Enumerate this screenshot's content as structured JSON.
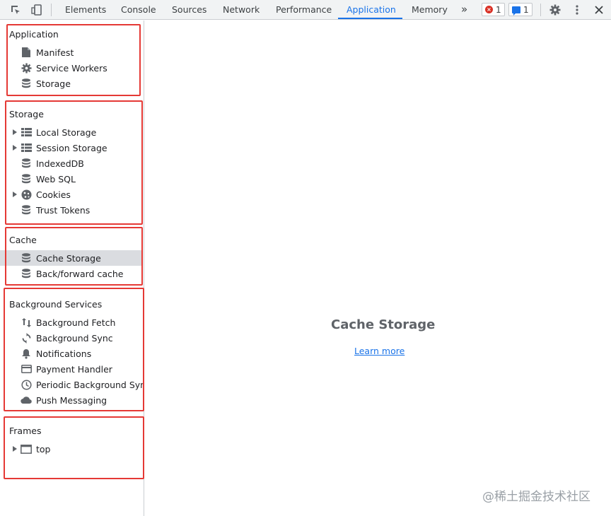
{
  "toolbar": {
    "tabs": [
      {
        "label": "Elements"
      },
      {
        "label": "Console"
      },
      {
        "label": "Sources"
      },
      {
        "label": "Network"
      },
      {
        "label": "Performance"
      },
      {
        "label": "Application"
      },
      {
        "label": "Memory"
      }
    ],
    "active_tab": "Application",
    "more_tabs_glyph": "»",
    "error_count": "1",
    "message_count": "1"
  },
  "sidebar": {
    "sections": [
      {
        "title": "Application",
        "items": [
          {
            "label": "Manifest",
            "icon": "document-icon"
          },
          {
            "label": "Service Workers",
            "icon": "gear-icon"
          },
          {
            "label": "Storage",
            "icon": "database-icon"
          }
        ]
      },
      {
        "title": "Storage",
        "items": [
          {
            "label": "Local Storage",
            "icon": "grid-icon",
            "expandable": true
          },
          {
            "label": "Session Storage",
            "icon": "grid-icon",
            "expandable": true
          },
          {
            "label": "IndexedDB",
            "icon": "database-icon"
          },
          {
            "label": "Web SQL",
            "icon": "database-icon"
          },
          {
            "label": "Cookies",
            "icon": "cookie-icon",
            "expandable": true
          },
          {
            "label": "Trust Tokens",
            "icon": "database-icon"
          }
        ]
      },
      {
        "title": "Cache",
        "items": [
          {
            "label": "Cache Storage",
            "icon": "database-icon",
            "selected": true
          },
          {
            "label": "Back/forward cache",
            "icon": "database-icon"
          }
        ]
      },
      {
        "title": "Background Services",
        "items": [
          {
            "label": "Background Fetch",
            "icon": "arrows-updown-icon"
          },
          {
            "label": "Background Sync",
            "icon": "sync-icon"
          },
          {
            "label": "Notifications",
            "icon": "bell-icon"
          },
          {
            "label": "Payment Handler",
            "icon": "card-icon"
          },
          {
            "label": "Periodic Background Sync",
            "icon": "clock-icon"
          },
          {
            "label": "Push Messaging",
            "icon": "cloud-icon"
          }
        ]
      },
      {
        "title": "Frames",
        "items": [
          {
            "label": "top",
            "icon": "frame-icon",
            "expandable": true
          }
        ]
      }
    ]
  },
  "main": {
    "title": "Cache Storage",
    "learn_more": "Learn more"
  },
  "watermark": "@稀土掘金技术社区",
  "colors": {
    "accent": "#1a73e8",
    "highlight_box": "#e53935",
    "selected_bg": "#dadce0"
  }
}
